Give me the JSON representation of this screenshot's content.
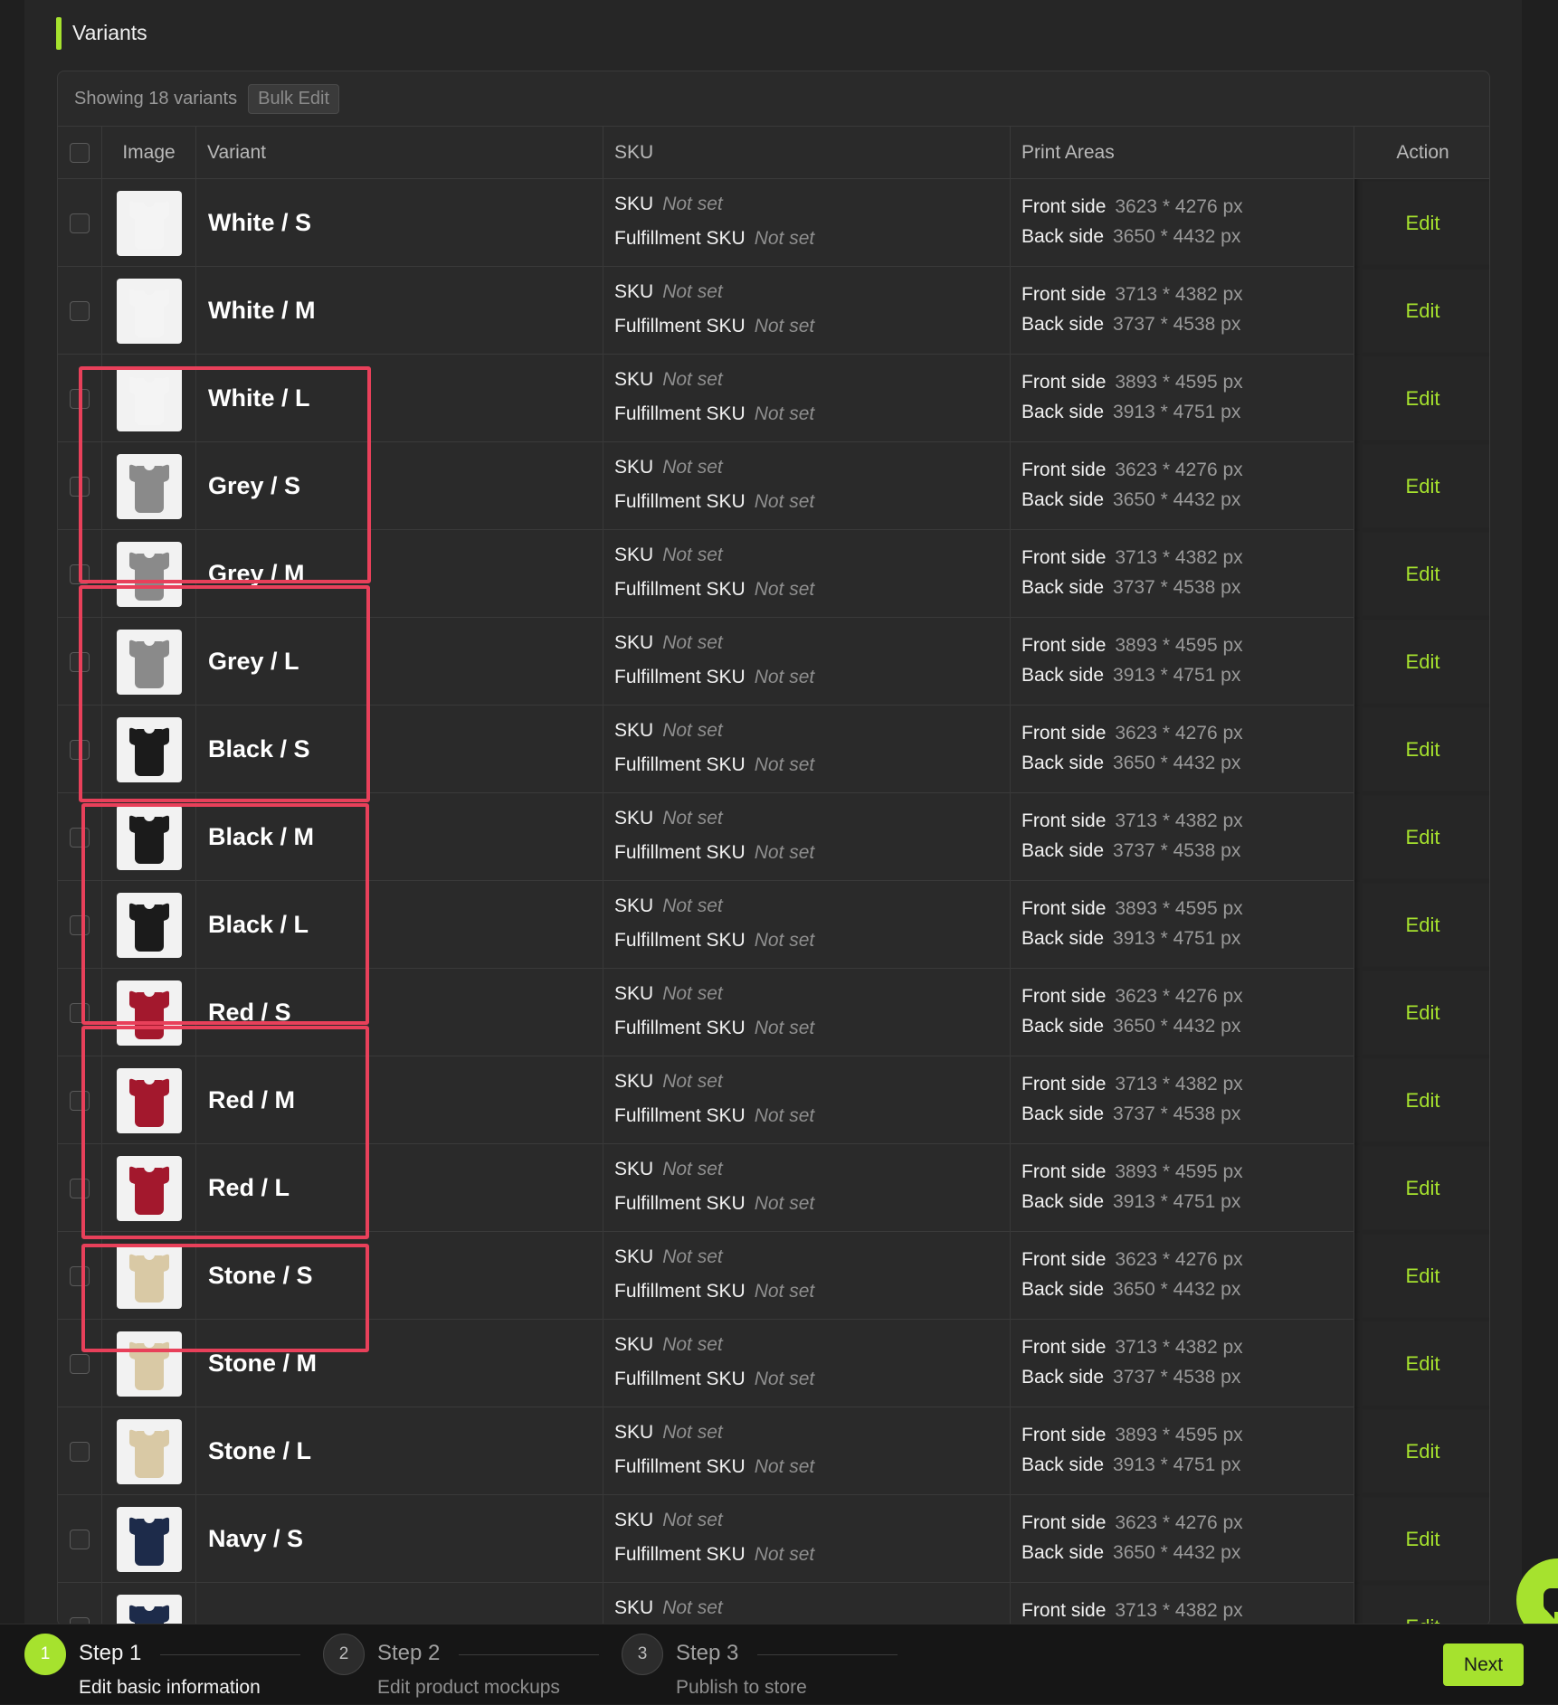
{
  "section": {
    "title": "Variants"
  },
  "toolbar": {
    "showing": "Showing 18 variants",
    "bulk_edit": "Bulk Edit"
  },
  "columns": {
    "image": "Image",
    "variant": "Variant",
    "sku": "SKU",
    "print_areas": "Print Areas",
    "action": "Action"
  },
  "labels": {
    "sku": "SKU",
    "fulfillment_sku": "Fulfillment SKU",
    "not_set": "Not set",
    "front_side": "Front side",
    "back_side": "Back side",
    "edit": "Edit"
  },
  "colors": {
    "accent": "#a6e22e",
    "highlight": "#e8405a"
  },
  "variants": [
    {
      "name": "White / S",
      "color": "#f4f4f4",
      "front": "3623 * 4276 px",
      "back": "3650 * 4432 px"
    },
    {
      "name": "White / M",
      "color": "#f4f4f4",
      "front": "3713 * 4382 px",
      "back": "3737 * 4538 px"
    },
    {
      "name": "White / L",
      "color": "#f4f4f4",
      "front": "3893 * 4595 px",
      "back": "3913 * 4751 px"
    },
    {
      "name": "Grey / S",
      "color": "#8a8a8a",
      "front": "3623 * 4276 px",
      "back": "3650 * 4432 px"
    },
    {
      "name": "Grey / M",
      "color": "#8a8a8a",
      "front": "3713 * 4382 px",
      "back": "3737 * 4538 px"
    },
    {
      "name": "Grey / L",
      "color": "#8a8a8a",
      "front": "3893 * 4595 px",
      "back": "3913 * 4751 px"
    },
    {
      "name": "Black / S",
      "color": "#1b1b1b",
      "front": "3623 * 4276 px",
      "back": "3650 * 4432 px"
    },
    {
      "name": "Black / M",
      "color": "#1b1b1b",
      "front": "3713 * 4382 px",
      "back": "3737 * 4538 px"
    },
    {
      "name": "Black / L",
      "color": "#1b1b1b",
      "front": "3893 * 4595 px",
      "back": "3913 * 4751 px"
    },
    {
      "name": "Red / S",
      "color": "#a3182d",
      "front": "3623 * 4276 px",
      "back": "3650 * 4432 px"
    },
    {
      "name": "Red / M",
      "color": "#a3182d",
      "front": "3713 * 4382 px",
      "back": "3737 * 4538 px"
    },
    {
      "name": "Red / L",
      "color": "#a3182d",
      "front": "3893 * 4595 px",
      "back": "3913 * 4751 px"
    },
    {
      "name": "Stone / S",
      "color": "#d9c9a5",
      "front": "3623 * 4276 px",
      "back": "3650 * 4432 px"
    },
    {
      "name": "Stone / M",
      "color": "#d9c9a5",
      "front": "3713 * 4382 px",
      "back": "3737 * 4538 px"
    },
    {
      "name": "Stone / L",
      "color": "#d9c9a5",
      "front": "3893 * 4595 px",
      "back": "3913 * 4751 px"
    },
    {
      "name": "Navy / S",
      "color": "#1d2b4a",
      "front": "3623 * 4276 px",
      "back": "3650 * 4432 px"
    },
    {
      "name": "",
      "color": "#1d2b4a",
      "front": "3713 * 4382 px",
      "back": ""
    }
  ],
  "steps": [
    {
      "number": "1",
      "title": "Step 1",
      "subtitle": "Edit basic information",
      "active": true
    },
    {
      "number": "2",
      "title": "Step 2",
      "subtitle": "Edit product mockups",
      "active": false
    },
    {
      "number": "3",
      "title": "Step 3",
      "subtitle": "Publish to store",
      "active": false
    }
  ],
  "footer": {
    "next": "Next"
  },
  "icons": {
    "chat": "chat-bubble-icon",
    "checkbox": "checkbox-icon",
    "shirt": "tshirt-icon"
  }
}
